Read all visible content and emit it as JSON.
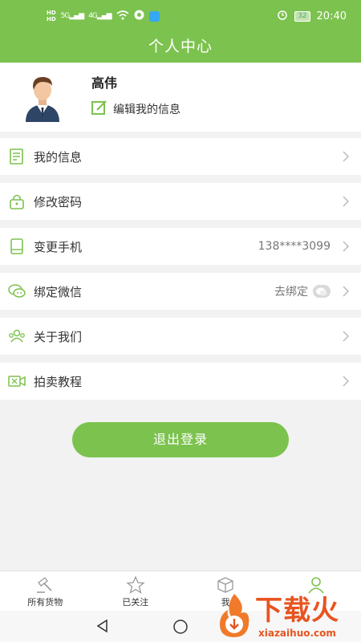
{
  "status_bar": {
    "time": "20:40",
    "battery": "32",
    "network_left": "5G",
    "network_right": "4G"
  },
  "header": {
    "title": "个人中心"
  },
  "profile": {
    "name": "高伟",
    "edit_label": "编辑我的信息"
  },
  "menu": {
    "items": [
      {
        "label": "我的信息",
        "icon": "document-icon"
      },
      {
        "label": "修改密码",
        "icon": "lock-icon"
      },
      {
        "label": "变更手机",
        "icon": "phone-icon",
        "value": "138****3099"
      },
      {
        "label": "绑定微信",
        "icon": "wechat-icon",
        "value": "去绑定"
      },
      {
        "label": "关于我们",
        "icon": "group-icon"
      },
      {
        "label": "拍卖教程",
        "icon": "video-icon"
      }
    ]
  },
  "logout_label": "退出登录",
  "tabs": [
    {
      "label": "所有货物",
      "icon": "gavel-icon"
    },
    {
      "label": "已关注",
      "icon": "star-icon"
    },
    {
      "label": "我",
      "icon": "box-icon"
    },
    {
      "label": "",
      "icon": "person-icon"
    }
  ],
  "watermark": {
    "text": "下载火",
    "url": "xiazaihuo.com"
  },
  "colors": {
    "accent": "#7cc24e",
    "watermark": "#e8541f"
  }
}
